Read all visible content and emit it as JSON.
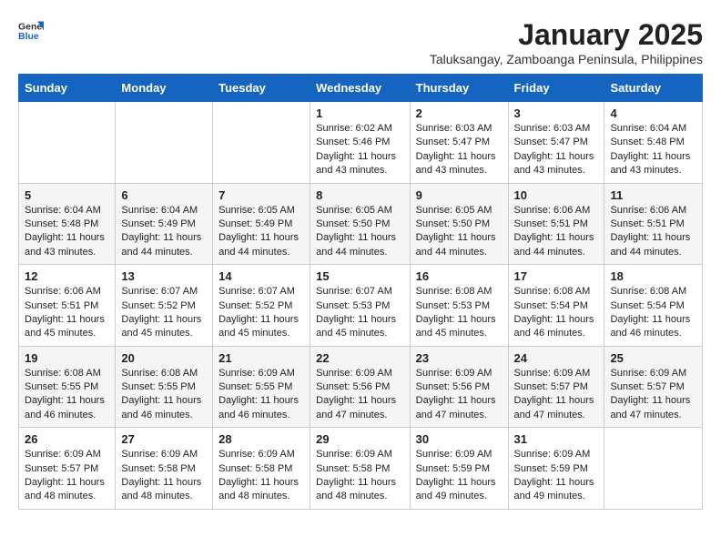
{
  "logo": {
    "general": "General",
    "blue": "Blue"
  },
  "title": "January 2025",
  "subtitle": "Taluksangay, Zamboanga Peninsula, Philippines",
  "weekdays": [
    "Sunday",
    "Monday",
    "Tuesday",
    "Wednesday",
    "Thursday",
    "Friday",
    "Saturday"
  ],
  "weeks": [
    [
      {
        "day": "",
        "sunrise": "",
        "sunset": "",
        "daylight": ""
      },
      {
        "day": "",
        "sunrise": "",
        "sunset": "",
        "daylight": ""
      },
      {
        "day": "",
        "sunrise": "",
        "sunset": "",
        "daylight": ""
      },
      {
        "day": "1",
        "sunrise": "Sunrise: 6:02 AM",
        "sunset": "Sunset: 5:46 PM",
        "daylight": "Daylight: 11 hours and 43 minutes."
      },
      {
        "day": "2",
        "sunrise": "Sunrise: 6:03 AM",
        "sunset": "Sunset: 5:47 PM",
        "daylight": "Daylight: 11 hours and 43 minutes."
      },
      {
        "day": "3",
        "sunrise": "Sunrise: 6:03 AM",
        "sunset": "Sunset: 5:47 PM",
        "daylight": "Daylight: 11 hours and 43 minutes."
      },
      {
        "day": "4",
        "sunrise": "Sunrise: 6:04 AM",
        "sunset": "Sunset: 5:48 PM",
        "daylight": "Daylight: 11 hours and 43 minutes."
      }
    ],
    [
      {
        "day": "5",
        "sunrise": "Sunrise: 6:04 AM",
        "sunset": "Sunset: 5:48 PM",
        "daylight": "Daylight: 11 hours and 43 minutes."
      },
      {
        "day": "6",
        "sunrise": "Sunrise: 6:04 AM",
        "sunset": "Sunset: 5:49 PM",
        "daylight": "Daylight: 11 hours and 44 minutes."
      },
      {
        "day": "7",
        "sunrise": "Sunrise: 6:05 AM",
        "sunset": "Sunset: 5:49 PM",
        "daylight": "Daylight: 11 hours and 44 minutes."
      },
      {
        "day": "8",
        "sunrise": "Sunrise: 6:05 AM",
        "sunset": "Sunset: 5:50 PM",
        "daylight": "Daylight: 11 hours and 44 minutes."
      },
      {
        "day": "9",
        "sunrise": "Sunrise: 6:05 AM",
        "sunset": "Sunset: 5:50 PM",
        "daylight": "Daylight: 11 hours and 44 minutes."
      },
      {
        "day": "10",
        "sunrise": "Sunrise: 6:06 AM",
        "sunset": "Sunset: 5:51 PM",
        "daylight": "Daylight: 11 hours and 44 minutes."
      },
      {
        "day": "11",
        "sunrise": "Sunrise: 6:06 AM",
        "sunset": "Sunset: 5:51 PM",
        "daylight": "Daylight: 11 hours and 44 minutes."
      }
    ],
    [
      {
        "day": "12",
        "sunrise": "Sunrise: 6:06 AM",
        "sunset": "Sunset: 5:51 PM",
        "daylight": "Daylight: 11 hours and 45 minutes."
      },
      {
        "day": "13",
        "sunrise": "Sunrise: 6:07 AM",
        "sunset": "Sunset: 5:52 PM",
        "daylight": "Daylight: 11 hours and 45 minutes."
      },
      {
        "day": "14",
        "sunrise": "Sunrise: 6:07 AM",
        "sunset": "Sunset: 5:52 PM",
        "daylight": "Daylight: 11 hours and 45 minutes."
      },
      {
        "day": "15",
        "sunrise": "Sunrise: 6:07 AM",
        "sunset": "Sunset: 5:53 PM",
        "daylight": "Daylight: 11 hours and 45 minutes."
      },
      {
        "day": "16",
        "sunrise": "Sunrise: 6:08 AM",
        "sunset": "Sunset: 5:53 PM",
        "daylight": "Daylight: 11 hours and 45 minutes."
      },
      {
        "day": "17",
        "sunrise": "Sunrise: 6:08 AM",
        "sunset": "Sunset: 5:54 PM",
        "daylight": "Daylight: 11 hours and 46 minutes."
      },
      {
        "day": "18",
        "sunrise": "Sunrise: 6:08 AM",
        "sunset": "Sunset: 5:54 PM",
        "daylight": "Daylight: 11 hours and 46 minutes."
      }
    ],
    [
      {
        "day": "19",
        "sunrise": "Sunrise: 6:08 AM",
        "sunset": "Sunset: 5:55 PM",
        "daylight": "Daylight: 11 hours and 46 minutes."
      },
      {
        "day": "20",
        "sunrise": "Sunrise: 6:08 AM",
        "sunset": "Sunset: 5:55 PM",
        "daylight": "Daylight: 11 hours and 46 minutes."
      },
      {
        "day": "21",
        "sunrise": "Sunrise: 6:09 AM",
        "sunset": "Sunset: 5:55 PM",
        "daylight": "Daylight: 11 hours and 46 minutes."
      },
      {
        "day": "22",
        "sunrise": "Sunrise: 6:09 AM",
        "sunset": "Sunset: 5:56 PM",
        "daylight": "Daylight: 11 hours and 47 minutes."
      },
      {
        "day": "23",
        "sunrise": "Sunrise: 6:09 AM",
        "sunset": "Sunset: 5:56 PM",
        "daylight": "Daylight: 11 hours and 47 minutes."
      },
      {
        "day": "24",
        "sunrise": "Sunrise: 6:09 AM",
        "sunset": "Sunset: 5:57 PM",
        "daylight": "Daylight: 11 hours and 47 minutes."
      },
      {
        "day": "25",
        "sunrise": "Sunrise: 6:09 AM",
        "sunset": "Sunset: 5:57 PM",
        "daylight": "Daylight: 11 hours and 47 minutes."
      }
    ],
    [
      {
        "day": "26",
        "sunrise": "Sunrise: 6:09 AM",
        "sunset": "Sunset: 5:57 PM",
        "daylight": "Daylight: 11 hours and 48 minutes."
      },
      {
        "day": "27",
        "sunrise": "Sunrise: 6:09 AM",
        "sunset": "Sunset: 5:58 PM",
        "daylight": "Daylight: 11 hours and 48 minutes."
      },
      {
        "day": "28",
        "sunrise": "Sunrise: 6:09 AM",
        "sunset": "Sunset: 5:58 PM",
        "daylight": "Daylight: 11 hours and 48 minutes."
      },
      {
        "day": "29",
        "sunrise": "Sunrise: 6:09 AM",
        "sunset": "Sunset: 5:58 PM",
        "daylight": "Daylight: 11 hours and 48 minutes."
      },
      {
        "day": "30",
        "sunrise": "Sunrise: 6:09 AM",
        "sunset": "Sunset: 5:59 PM",
        "daylight": "Daylight: 11 hours and 49 minutes."
      },
      {
        "day": "31",
        "sunrise": "Sunrise: 6:09 AM",
        "sunset": "Sunset: 5:59 PM",
        "daylight": "Daylight: 11 hours and 49 minutes."
      },
      {
        "day": "",
        "sunrise": "",
        "sunset": "",
        "daylight": ""
      }
    ]
  ]
}
